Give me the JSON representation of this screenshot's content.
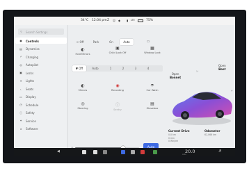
{
  "status_bar": {
    "temperature": "34°C",
    "time": "12:04 pm",
    "profile": "Z",
    "signal": "LTE",
    "battery": "75%"
  },
  "sidebar": {
    "search_placeholder": "Search Settings",
    "items": [
      {
        "label": "Controls",
        "icon": "toggle-icon",
        "active": true
      },
      {
        "label": "Dynamics",
        "icon": "car-icon"
      },
      {
        "label": "Charging",
        "icon": "bolt-icon"
      },
      {
        "label": "Autopilot",
        "icon": "steering-wheel-icon"
      },
      {
        "label": "Locks",
        "icon": "lock-icon"
      },
      {
        "label": "Lights",
        "icon": "light-icon"
      },
      {
        "label": "Seats",
        "icon": "seat-icon"
      },
      {
        "label": "Display",
        "icon": "display-icon"
      },
      {
        "label": "Schedule",
        "icon": "clock-icon"
      },
      {
        "label": "Safety",
        "icon": "shield-icon"
      },
      {
        "label": "Service",
        "icon": "wrench-icon"
      },
      {
        "label": "Software",
        "icon": "download-icon"
      }
    ]
  },
  "controls": {
    "headlight_modes": [
      "Off",
      "Park",
      "On",
      "Auto"
    ],
    "headlight_active": "Auto",
    "actions": [
      "Fold Mirrors",
      "Child Lock Off",
      "Window Lock"
    ],
    "wiper_speeds": [
      "Off",
      "Auto",
      "1",
      "2",
      "3",
      "4"
    ],
    "wiper_active": "Off",
    "features": [
      {
        "label": "Mirrors",
        "icon": "mirror-icon"
      },
      {
        "label": "Recording",
        "icon": "record-icon"
      },
      {
        "label": "Car Wash",
        "icon": "car-wash-icon"
      },
      {
        "label": "Steering",
        "icon": "steering-wheel-icon"
      },
      {
        "label": "Sentry",
        "icon": "shield-icon",
        "dim": true
      },
      {
        "label": "Glovebox",
        "icon": "glovebox-icon"
      }
    ],
    "brightness_label": "Auto",
    "brightness_level": 0.75
  },
  "car_panel": {
    "frunk_action": "Open",
    "frunk_label": "Bonnet",
    "trunk_action": "Open",
    "trunk_label": "Boot",
    "current_drive_label": "Current Drive",
    "current_drive_values": [
      "0.0 km",
      "0 min",
      "0 Wh/km"
    ],
    "odometer_label": "Odometer",
    "odometer_value": "62,066 km",
    "car_color": "#8a4fd6"
  },
  "taskbar": {
    "temperature": "20.0",
    "temperature_sub": "Auto",
    "icons": [
      "car-icon",
      "phone-icon",
      "media-icon",
      "bluetooth-icon",
      "camera-icon",
      "apps-icon",
      "calendar-icon"
    ]
  }
}
